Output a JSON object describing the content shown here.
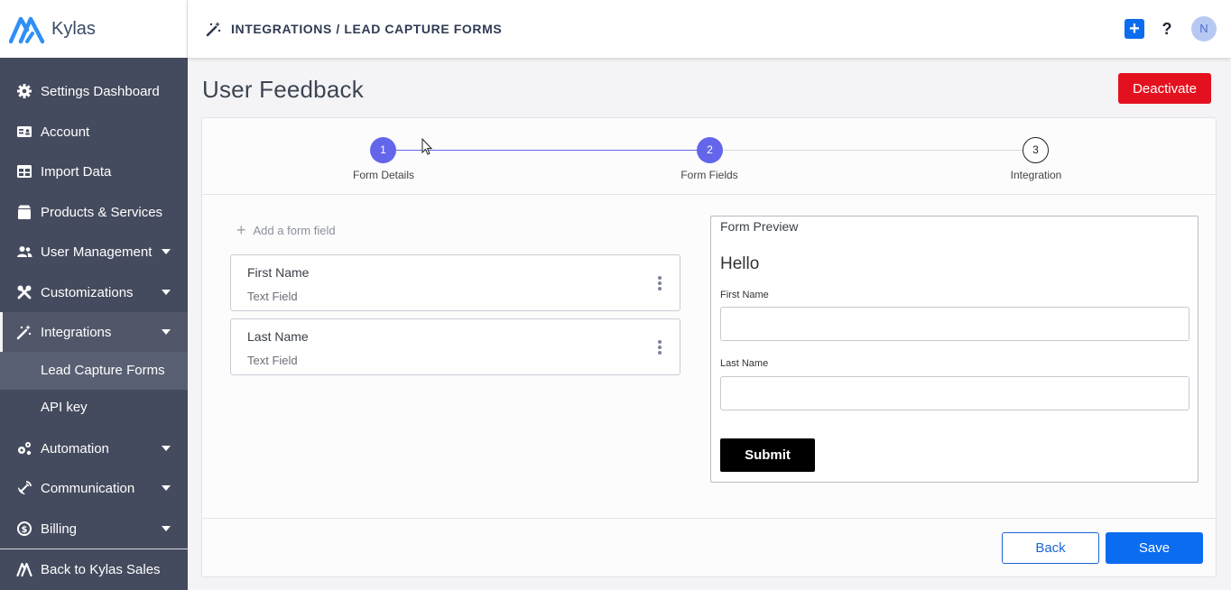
{
  "app": {
    "name": "Kylas"
  },
  "header": {
    "breadcrumb": "INTEGRATIONS / LEAD CAPTURE FORMS",
    "add_label": "+",
    "help_label": "?",
    "avatar_initial": "N"
  },
  "sidebar": {
    "items": [
      {
        "label": "Settings Dashboard",
        "icon": "gear-icon"
      },
      {
        "label": "Account",
        "icon": "account-card-icon"
      },
      {
        "label": "Import Data",
        "icon": "import-table-icon"
      },
      {
        "label": "Products & Services",
        "icon": "package-icon"
      },
      {
        "label": "User Management",
        "icon": "users-icon"
      },
      {
        "label": "Customizations",
        "icon": "tools-icon"
      },
      {
        "label": "Integrations",
        "icon": "magic-wand-icon"
      },
      {
        "label": "Automation",
        "icon": "cogs-icon"
      },
      {
        "label": "Communication",
        "icon": "satellite-icon"
      },
      {
        "label": "Billing",
        "icon": "dollar-circle-icon"
      },
      {
        "label": "Back to Kylas Sales",
        "icon": "kylas-logo-icon"
      }
    ],
    "subitems": [
      {
        "label": "Lead Capture Forms"
      },
      {
        "label": "API key"
      }
    ]
  },
  "page": {
    "title": "User Feedback",
    "deactivate_label": "Deactivate"
  },
  "stepper": {
    "steps": [
      {
        "number": "1",
        "label": "Form Details",
        "state": "complete"
      },
      {
        "number": "2",
        "label": "Form Fields",
        "state": "current"
      },
      {
        "number": "3",
        "label": "Integration",
        "state": "pending"
      }
    ]
  },
  "fields": {
    "add_label": "Add a form field",
    "items": [
      {
        "name": "First Name",
        "type": "Text Field"
      },
      {
        "name": "Last Name",
        "type": "Text Field"
      }
    ]
  },
  "preview": {
    "title": "Form Preview",
    "heading": "Hello",
    "first_name_label": "First Name",
    "last_name_label": "Last Name",
    "submit_label": "Submit"
  },
  "footer": {
    "back_label": "Back",
    "save_label": "Save"
  },
  "colors": {
    "primary": "#0b6cf0",
    "danger": "#e3111f",
    "step_active": "#6366ea",
    "sidebar_bg": "#454b5e"
  }
}
